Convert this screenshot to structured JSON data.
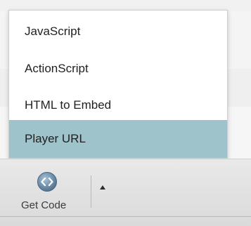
{
  "menu": {
    "items": [
      {
        "label": "JavaScript"
      },
      {
        "label": "ActionScript"
      },
      {
        "label": "HTML to Embed"
      },
      {
        "label": "Player URL"
      }
    ],
    "highlight_color": "#9ec3cb"
  },
  "toolbar": {
    "get_code_label": "Get Code",
    "get_code_icon": "code-brackets-icon",
    "menu_toggle_icon": "triangle-up-icon"
  }
}
